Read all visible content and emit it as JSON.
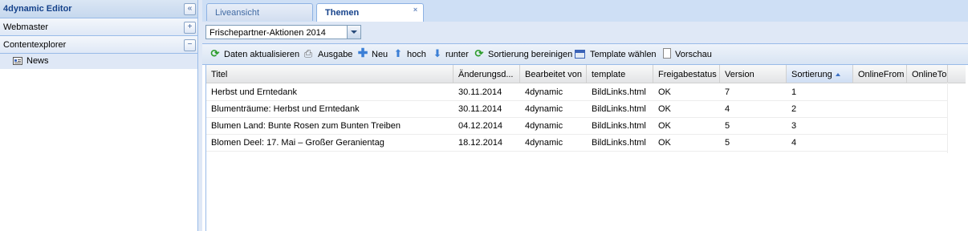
{
  "left_panel": {
    "title": "4dynamic Editor",
    "collapse_icon": "double-chevron-left-icon",
    "sections": [
      {
        "label": "Webmaster",
        "toggle": "+"
      },
      {
        "label": "Contentexplorer",
        "toggle": "−"
      }
    ],
    "tree": [
      {
        "label": "News",
        "icon": "list-page-icon"
      }
    ]
  },
  "tabs": [
    {
      "label": "Liveansicht",
      "active": false
    },
    {
      "label": "Themen",
      "active": true,
      "close": "×"
    }
  ],
  "selector": {
    "value": "Frischepartner-Aktionen 2014"
  },
  "toolbar": {
    "refresh": "Daten aktualisieren",
    "output": "Ausgabe",
    "new": "Neu",
    "up": "hoch",
    "down": "runter",
    "clean_sort": "Sortierung bereinigen",
    "template": "Template wählen",
    "preview": "Vorschau"
  },
  "grid": {
    "columns": [
      "Titel",
      "Änderungsd...",
      "Bearbeitet von",
      "template",
      "Freigabestatus",
      "Version",
      "Sortierung",
      "OnlineFrom",
      "OnlineTo"
    ],
    "sorted_column": "Sortierung",
    "sort_direction": "asc",
    "rows": [
      [
        "Herbst und Erntedank",
        "30.11.2014",
        "4dynamic",
        "BildLinks.html",
        "OK",
        "7",
        "1",
        "",
        ""
      ],
      [
        "Blumenträume: Herbst und Erntedank",
        "30.11.2014",
        "4dynamic",
        "BildLinks.html",
        "OK",
        "4",
        "2",
        "",
        ""
      ],
      [
        "Blumen Land: Bunte Rosen zum Bunten Treiben",
        "04.12.2014",
        "4dynamic",
        "BildLinks.html",
        "OK",
        "5",
        "3",
        "",
        ""
      ],
      [
        "Blomen Deel: 17. Mai – Großer Geranientag",
        "18.12.2014",
        "4dynamic",
        "BildLinks.html",
        "OK",
        "5",
        "4",
        "",
        ""
      ]
    ]
  }
}
